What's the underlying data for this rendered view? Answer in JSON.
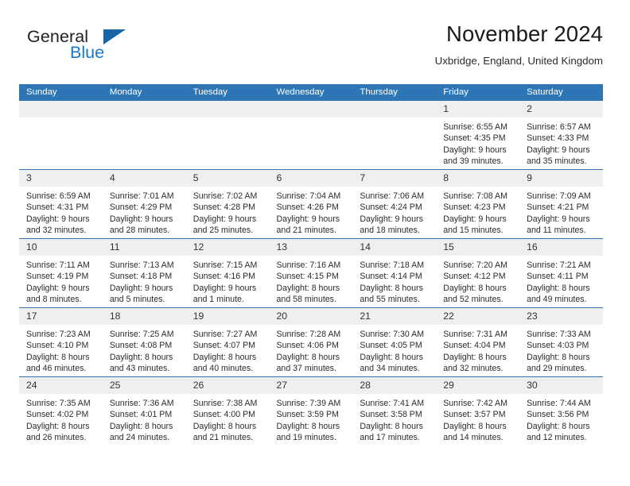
{
  "brand": {
    "name_part1": "General",
    "name_part2": "Blue",
    "triangle_color": "#1565a8",
    "blue_color": "#1878c8"
  },
  "header": {
    "month_title": "November 2024",
    "location": "Uxbridge, England, United Kingdom"
  },
  "theme": {
    "header_bg": "#2e75b6",
    "header_text": "#ffffff",
    "daynum_bg": "#efefef",
    "cell_text": "#2b2b2b",
    "row_divider": "#2e75b6"
  },
  "weekday_headers": [
    "Sunday",
    "Monday",
    "Tuesday",
    "Wednesday",
    "Thursday",
    "Friday",
    "Saturday"
  ],
  "weeks": [
    [
      {
        "day": "",
        "empty": true,
        "sunrise": "",
        "sunset": "",
        "daylight_line1": "",
        "daylight_line2": ""
      },
      {
        "day": "",
        "empty": true,
        "sunrise": "",
        "sunset": "",
        "daylight_line1": "",
        "daylight_line2": ""
      },
      {
        "day": "",
        "empty": true,
        "sunrise": "",
        "sunset": "",
        "daylight_line1": "",
        "daylight_line2": ""
      },
      {
        "day": "",
        "empty": true,
        "sunrise": "",
        "sunset": "",
        "daylight_line1": "",
        "daylight_line2": ""
      },
      {
        "day": "",
        "empty": true,
        "sunrise": "",
        "sunset": "",
        "daylight_line1": "",
        "daylight_line2": ""
      },
      {
        "day": "1",
        "empty": false,
        "sunrise": "Sunrise: 6:55 AM",
        "sunset": "Sunset: 4:35 PM",
        "daylight_line1": "Daylight: 9 hours",
        "daylight_line2": "and 39 minutes."
      },
      {
        "day": "2",
        "empty": false,
        "sunrise": "Sunrise: 6:57 AM",
        "sunset": "Sunset: 4:33 PM",
        "daylight_line1": "Daylight: 9 hours",
        "daylight_line2": "and 35 minutes."
      }
    ],
    [
      {
        "day": "3",
        "empty": false,
        "sunrise": "Sunrise: 6:59 AM",
        "sunset": "Sunset: 4:31 PM",
        "daylight_line1": "Daylight: 9 hours",
        "daylight_line2": "and 32 minutes."
      },
      {
        "day": "4",
        "empty": false,
        "sunrise": "Sunrise: 7:01 AM",
        "sunset": "Sunset: 4:29 PM",
        "daylight_line1": "Daylight: 9 hours",
        "daylight_line2": "and 28 minutes."
      },
      {
        "day": "5",
        "empty": false,
        "sunrise": "Sunrise: 7:02 AM",
        "sunset": "Sunset: 4:28 PM",
        "daylight_line1": "Daylight: 9 hours",
        "daylight_line2": "and 25 minutes."
      },
      {
        "day": "6",
        "empty": false,
        "sunrise": "Sunrise: 7:04 AM",
        "sunset": "Sunset: 4:26 PM",
        "daylight_line1": "Daylight: 9 hours",
        "daylight_line2": "and 21 minutes."
      },
      {
        "day": "7",
        "empty": false,
        "sunrise": "Sunrise: 7:06 AM",
        "sunset": "Sunset: 4:24 PM",
        "daylight_line1": "Daylight: 9 hours",
        "daylight_line2": "and 18 minutes."
      },
      {
        "day": "8",
        "empty": false,
        "sunrise": "Sunrise: 7:08 AM",
        "sunset": "Sunset: 4:23 PM",
        "daylight_line1": "Daylight: 9 hours",
        "daylight_line2": "and 15 minutes."
      },
      {
        "day": "9",
        "empty": false,
        "sunrise": "Sunrise: 7:09 AM",
        "sunset": "Sunset: 4:21 PM",
        "daylight_line1": "Daylight: 9 hours",
        "daylight_line2": "and 11 minutes."
      }
    ],
    [
      {
        "day": "10",
        "empty": false,
        "sunrise": "Sunrise: 7:11 AM",
        "sunset": "Sunset: 4:19 PM",
        "daylight_line1": "Daylight: 9 hours",
        "daylight_line2": "and 8 minutes."
      },
      {
        "day": "11",
        "empty": false,
        "sunrise": "Sunrise: 7:13 AM",
        "sunset": "Sunset: 4:18 PM",
        "daylight_line1": "Daylight: 9 hours",
        "daylight_line2": "and 5 minutes."
      },
      {
        "day": "12",
        "empty": false,
        "sunrise": "Sunrise: 7:15 AM",
        "sunset": "Sunset: 4:16 PM",
        "daylight_line1": "Daylight: 9 hours",
        "daylight_line2": "and 1 minute."
      },
      {
        "day": "13",
        "empty": false,
        "sunrise": "Sunrise: 7:16 AM",
        "sunset": "Sunset: 4:15 PM",
        "daylight_line1": "Daylight: 8 hours",
        "daylight_line2": "and 58 minutes."
      },
      {
        "day": "14",
        "empty": false,
        "sunrise": "Sunrise: 7:18 AM",
        "sunset": "Sunset: 4:14 PM",
        "daylight_line1": "Daylight: 8 hours",
        "daylight_line2": "and 55 minutes."
      },
      {
        "day": "15",
        "empty": false,
        "sunrise": "Sunrise: 7:20 AM",
        "sunset": "Sunset: 4:12 PM",
        "daylight_line1": "Daylight: 8 hours",
        "daylight_line2": "and 52 minutes."
      },
      {
        "day": "16",
        "empty": false,
        "sunrise": "Sunrise: 7:21 AM",
        "sunset": "Sunset: 4:11 PM",
        "daylight_line1": "Daylight: 8 hours",
        "daylight_line2": "and 49 minutes."
      }
    ],
    [
      {
        "day": "17",
        "empty": false,
        "sunrise": "Sunrise: 7:23 AM",
        "sunset": "Sunset: 4:10 PM",
        "daylight_line1": "Daylight: 8 hours",
        "daylight_line2": "and 46 minutes."
      },
      {
        "day": "18",
        "empty": false,
        "sunrise": "Sunrise: 7:25 AM",
        "sunset": "Sunset: 4:08 PM",
        "daylight_line1": "Daylight: 8 hours",
        "daylight_line2": "and 43 minutes."
      },
      {
        "day": "19",
        "empty": false,
        "sunrise": "Sunrise: 7:27 AM",
        "sunset": "Sunset: 4:07 PM",
        "daylight_line1": "Daylight: 8 hours",
        "daylight_line2": "and 40 minutes."
      },
      {
        "day": "20",
        "empty": false,
        "sunrise": "Sunrise: 7:28 AM",
        "sunset": "Sunset: 4:06 PM",
        "daylight_line1": "Daylight: 8 hours",
        "daylight_line2": "and 37 minutes."
      },
      {
        "day": "21",
        "empty": false,
        "sunrise": "Sunrise: 7:30 AM",
        "sunset": "Sunset: 4:05 PM",
        "daylight_line1": "Daylight: 8 hours",
        "daylight_line2": "and 34 minutes."
      },
      {
        "day": "22",
        "empty": false,
        "sunrise": "Sunrise: 7:31 AM",
        "sunset": "Sunset: 4:04 PM",
        "daylight_line1": "Daylight: 8 hours",
        "daylight_line2": "and 32 minutes."
      },
      {
        "day": "23",
        "empty": false,
        "sunrise": "Sunrise: 7:33 AM",
        "sunset": "Sunset: 4:03 PM",
        "daylight_line1": "Daylight: 8 hours",
        "daylight_line2": "and 29 minutes."
      }
    ],
    [
      {
        "day": "24",
        "empty": false,
        "sunrise": "Sunrise: 7:35 AM",
        "sunset": "Sunset: 4:02 PM",
        "daylight_line1": "Daylight: 8 hours",
        "daylight_line2": "and 26 minutes."
      },
      {
        "day": "25",
        "empty": false,
        "sunrise": "Sunrise: 7:36 AM",
        "sunset": "Sunset: 4:01 PM",
        "daylight_line1": "Daylight: 8 hours",
        "daylight_line2": "and 24 minutes."
      },
      {
        "day": "26",
        "empty": false,
        "sunrise": "Sunrise: 7:38 AM",
        "sunset": "Sunset: 4:00 PM",
        "daylight_line1": "Daylight: 8 hours",
        "daylight_line2": "and 21 minutes."
      },
      {
        "day": "27",
        "empty": false,
        "sunrise": "Sunrise: 7:39 AM",
        "sunset": "Sunset: 3:59 PM",
        "daylight_line1": "Daylight: 8 hours",
        "daylight_line2": "and 19 minutes."
      },
      {
        "day": "28",
        "empty": false,
        "sunrise": "Sunrise: 7:41 AM",
        "sunset": "Sunset: 3:58 PM",
        "daylight_line1": "Daylight: 8 hours",
        "daylight_line2": "and 17 minutes."
      },
      {
        "day": "29",
        "empty": false,
        "sunrise": "Sunrise: 7:42 AM",
        "sunset": "Sunset: 3:57 PM",
        "daylight_line1": "Daylight: 8 hours",
        "daylight_line2": "and 14 minutes."
      },
      {
        "day": "30",
        "empty": false,
        "sunrise": "Sunrise: 7:44 AM",
        "sunset": "Sunset: 3:56 PM",
        "daylight_line1": "Daylight: 8 hours",
        "daylight_line2": "and 12 minutes."
      }
    ]
  ]
}
